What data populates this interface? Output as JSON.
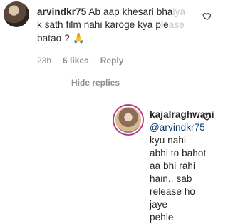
{
  "comment": {
    "username": "arvindkr75",
    "text_line1": "Ab aap khesari bha",
    "text_line1_faded": "iya",
    "text_line2": "k sath film nahi karoge kya ple",
    "text_line2_faded": "ase",
    "text_line3": "batao ?",
    "emoji": "🙏",
    "time": "23h",
    "likes": "6 likes",
    "reply_label": "Reply"
  },
  "hide_replies": {
    "label": "Hide replies"
  },
  "reply": {
    "username": "kajalraghwani",
    "mention": "@arvindkr75",
    "text_after_mention": " kyu nahi",
    "line2": "abhi to bahot aa bhi rahi",
    "line3": "hain.. sab release ho jaye",
    "line4": "pehle"
  },
  "icons": {
    "heart": "heart-outline-icon",
    "pray": "folded-hands-icon",
    "avatar1": "avatar",
    "avatar2": "avatar"
  },
  "colors": {
    "text": "#262626",
    "meta": "#8e8e8e",
    "mention": "#00376b",
    "story_ring": "#c13584"
  }
}
